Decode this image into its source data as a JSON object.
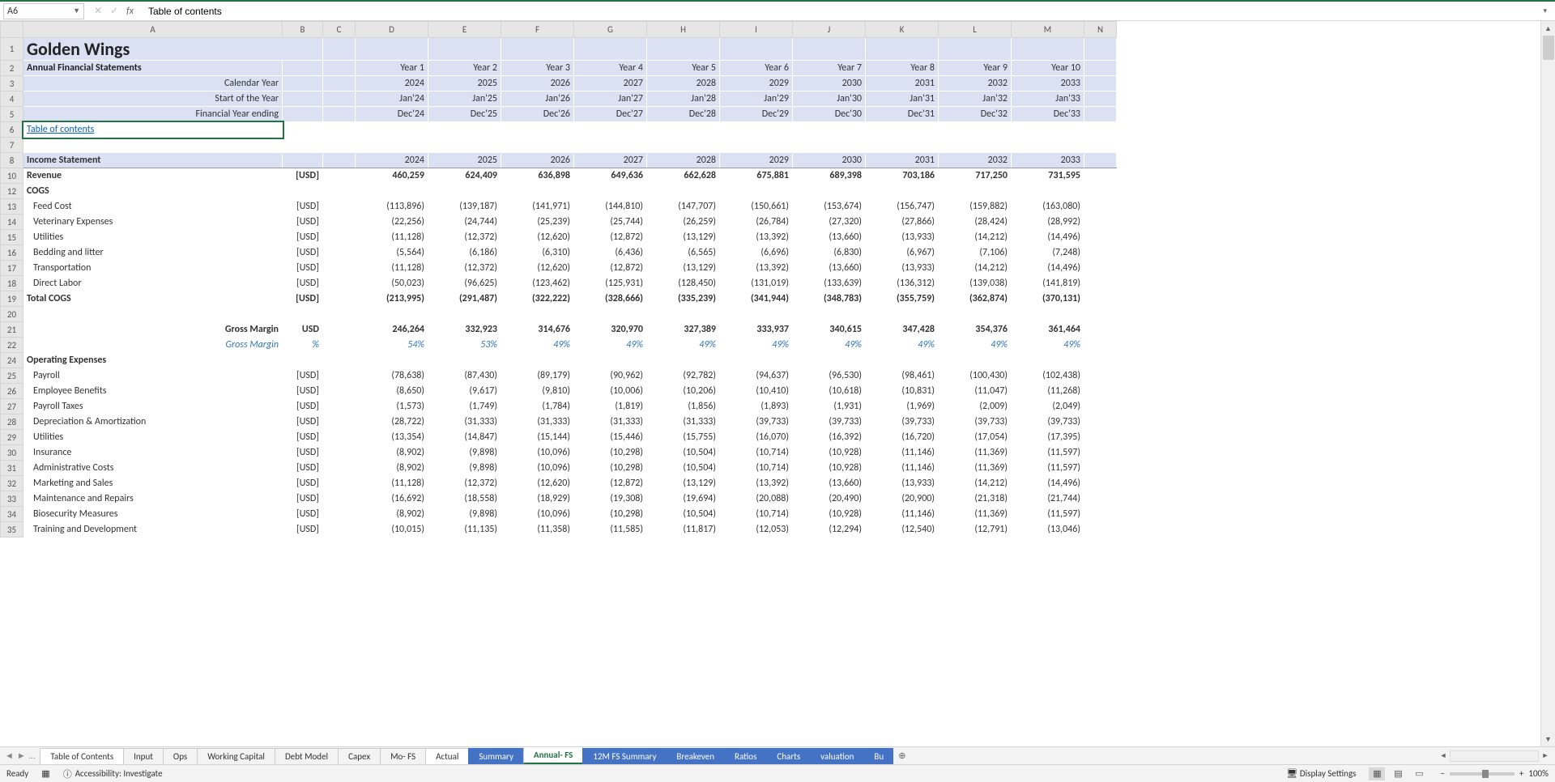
{
  "namebox": "A6",
  "formula": "Table of contents",
  "columns": [
    "",
    "A",
    "B",
    "C",
    "D",
    "E",
    "F",
    "G",
    "H",
    "I",
    "J",
    "K",
    "L",
    "M",
    "N"
  ],
  "header": {
    "title": "Golden Wings",
    "subtitle": "Annual Financial Statements",
    "rows": [
      {
        "label": "",
        "vals": [
          "Year 1",
          "Year 2",
          "Year 3",
          "Year 4",
          "Year 5",
          "Year 6",
          "Year 7",
          "Year 8",
          "Year 9",
          "Year 10"
        ]
      },
      {
        "label": "Calendar Year",
        "vals": [
          "2024",
          "2025",
          "2026",
          "2027",
          "2028",
          "2029",
          "2030",
          "2031",
          "2032",
          "2033"
        ]
      },
      {
        "label": "Start of the Year",
        "vals": [
          "Jan'24",
          "Jan'25",
          "Jan'26",
          "Jan'27",
          "Jan'28",
          "Jan'29",
          "Jan'30",
          "Jan'31",
          "Jan'32",
          "Jan'33"
        ]
      },
      {
        "label": "Financial Year ending",
        "vals": [
          "Dec'24",
          "Dec'25",
          "Dec'26",
          "Dec'27",
          "Dec'28",
          "Dec'29",
          "Dec'30",
          "Dec'31",
          "Dec'32",
          "Dec'33"
        ]
      }
    ]
  },
  "toc": "Table of contents",
  "income_header": {
    "label": "Income Statement",
    "vals": [
      "2024",
      "2025",
      "2026",
      "2027",
      "2028",
      "2029",
      "2030",
      "2031",
      "2032",
      "2033"
    ]
  },
  "revenue": {
    "label": "Revenue",
    "unit": "[USD]",
    "vals": [
      "460,259",
      "624,409",
      "636,898",
      "649,636",
      "662,628",
      "675,881",
      "689,398",
      "703,186",
      "717,250",
      "731,595"
    ]
  },
  "cogs_label": "COGS",
  "cogs": [
    {
      "label": "Feed Cost",
      "unit": "[USD]",
      "vals": [
        "(113,896)",
        "(139,187)",
        "(141,971)",
        "(144,810)",
        "(147,707)",
        "(150,661)",
        "(153,674)",
        "(156,747)",
        "(159,882)",
        "(163,080)"
      ]
    },
    {
      "label": "Veterinary Expenses",
      "unit": "[USD]",
      "vals": [
        "(22,256)",
        "(24,744)",
        "(25,239)",
        "(25,744)",
        "(26,259)",
        "(26,784)",
        "(27,320)",
        "(27,866)",
        "(28,424)",
        "(28,992)"
      ]
    },
    {
      "label": "Utilities",
      "unit": "[USD]",
      "vals": [
        "(11,128)",
        "(12,372)",
        "(12,620)",
        "(12,872)",
        "(13,129)",
        "(13,392)",
        "(13,660)",
        "(13,933)",
        "(14,212)",
        "(14,496)"
      ]
    },
    {
      "label": "Bedding and litter",
      "unit": "[USD]",
      "vals": [
        "(5,564)",
        "(6,186)",
        "(6,310)",
        "(6,436)",
        "(6,565)",
        "(6,696)",
        "(6,830)",
        "(6,967)",
        "(7,106)",
        "(7,248)"
      ]
    },
    {
      "label": "Transportation",
      "unit": "[USD]",
      "vals": [
        "(11,128)",
        "(12,372)",
        "(12,620)",
        "(12,872)",
        "(13,129)",
        "(13,392)",
        "(13,660)",
        "(13,933)",
        "(14,212)",
        "(14,496)"
      ]
    },
    {
      "label": "Direct Labor",
      "unit": "[USD]",
      "vals": [
        "(50,023)",
        "(96,625)",
        "(123,462)",
        "(125,931)",
        "(128,450)",
        "(131,019)",
        "(133,639)",
        "(136,312)",
        "(139,038)",
        "(141,819)"
      ]
    }
  ],
  "total_cogs": {
    "label": "Total COGS",
    "unit": "[USD]",
    "vals": [
      "(213,995)",
      "(291,487)",
      "(322,222)",
      "(328,666)",
      "(335,239)",
      "(341,944)",
      "(348,783)",
      "(355,759)",
      "(362,874)",
      "(370,131)"
    ]
  },
  "gross_margin": {
    "label": "Gross Margin",
    "unit": "USD",
    "vals": [
      "246,264",
      "332,923",
      "314,676",
      "320,970",
      "327,389",
      "333,937",
      "340,615",
      "347,428",
      "354,376",
      "361,464"
    ]
  },
  "gross_margin_pct": {
    "label": "Gross Margin",
    "unit": "%",
    "vals": [
      "54%",
      "53%",
      "49%",
      "49%",
      "49%",
      "49%",
      "49%",
      "49%",
      "49%",
      "49%"
    ]
  },
  "opex_label": "Operating Expenses",
  "opex": [
    {
      "label": "Payroll",
      "unit": "[USD]",
      "vals": [
        "(78,638)",
        "(87,430)",
        "(89,179)",
        "(90,962)",
        "(92,782)",
        "(94,637)",
        "(96,530)",
        "(98,461)",
        "(100,430)",
        "(102,438)"
      ]
    },
    {
      "label": "Employee Benefits",
      "unit": "[USD]",
      "vals": [
        "(8,650)",
        "(9,617)",
        "(9,810)",
        "(10,006)",
        "(10,206)",
        "(10,410)",
        "(10,618)",
        "(10,831)",
        "(11,047)",
        "(11,268)"
      ]
    },
    {
      "label": "Payroll Taxes",
      "unit": "[USD]",
      "vals": [
        "(1,573)",
        "(1,749)",
        "(1,784)",
        "(1,819)",
        "(1,856)",
        "(1,893)",
        "(1,931)",
        "(1,969)",
        "(2,009)",
        "(2,049)"
      ]
    },
    {
      "label": "Depreciation & Amortization",
      "unit": "[USD]",
      "vals": [
        "(28,722)",
        "(31,333)",
        "(31,333)",
        "(31,333)",
        "(31,333)",
        "(39,733)",
        "(39,733)",
        "(39,733)",
        "(39,733)",
        "(39,733)"
      ]
    },
    {
      "label": "Utilities",
      "unit": "[USD]",
      "vals": [
        "(13,354)",
        "(14,847)",
        "(15,144)",
        "(15,446)",
        "(15,755)",
        "(16,070)",
        "(16,392)",
        "(16,720)",
        "(17,054)",
        "(17,395)"
      ]
    },
    {
      "label": "Insurance",
      "unit": "[USD]",
      "vals": [
        "(8,902)",
        "(9,898)",
        "(10,096)",
        "(10,298)",
        "(10,504)",
        "(10,714)",
        "(10,928)",
        "(11,146)",
        "(11,369)",
        "(11,597)"
      ]
    },
    {
      "label": "Administrative Costs",
      "unit": "[USD]",
      "vals": [
        "(8,902)",
        "(9,898)",
        "(10,096)",
        "(10,298)",
        "(10,504)",
        "(10,714)",
        "(10,928)",
        "(11,146)",
        "(11,369)",
        "(11,597)"
      ]
    },
    {
      "label": "Marketing and Sales",
      "unit": "[USD]",
      "vals": [
        "(11,128)",
        "(12,372)",
        "(12,620)",
        "(12,872)",
        "(13,129)",
        "(13,392)",
        "(13,660)",
        "(13,933)",
        "(14,212)",
        "(14,496)"
      ]
    },
    {
      "label": "Maintenance and Repairs",
      "unit": "[USD]",
      "vals": [
        "(16,692)",
        "(18,558)",
        "(18,929)",
        "(19,308)",
        "(19,694)",
        "(20,088)",
        "(20,490)",
        "(20,900)",
        "(21,318)",
        "(21,744)"
      ]
    },
    {
      "label": "Biosecurity Measures",
      "unit": "[USD]",
      "vals": [
        "(8,902)",
        "(9,898)",
        "(10,096)",
        "(10,298)",
        "(10,504)",
        "(10,714)",
        "(10,928)",
        "(11,146)",
        "(11,369)",
        "(11,597)"
      ]
    },
    {
      "label": "Training and Development",
      "unit": "[USD]",
      "vals": [
        "(10,015)",
        "(11,135)",
        "(11,358)",
        "(11,585)",
        "(11,817)",
        "(12,053)",
        "(12,294)",
        "(12,540)",
        "(12,791)",
        "(13,046)"
      ]
    }
  ],
  "tabs": [
    {
      "label": "Table of Contents",
      "cls": "white"
    },
    {
      "label": "Input",
      "cls": ""
    },
    {
      "label": "Ops",
      "cls": ""
    },
    {
      "label": "Working Capital",
      "cls": ""
    },
    {
      "label": "Debt Model",
      "cls": ""
    },
    {
      "label": "Capex",
      "cls": ""
    },
    {
      "label": "Mo- FS",
      "cls": ""
    },
    {
      "label": "Actual",
      "cls": "white"
    },
    {
      "label": "Summary",
      "cls": "blue"
    },
    {
      "label": "Annual- FS",
      "cls": "green"
    },
    {
      "label": "12M FS Summary",
      "cls": "blue"
    },
    {
      "label": "Breakeven",
      "cls": "blue"
    },
    {
      "label": "Ratios",
      "cls": "blue"
    },
    {
      "label": "Charts",
      "cls": "blue"
    },
    {
      "label": "valuation",
      "cls": "blue"
    },
    {
      "label": "Bu",
      "cls": "blue"
    }
  ],
  "status": {
    "ready": "Ready",
    "accessibility": "Accessibility: Investigate",
    "display": "Display Settings",
    "zoom": "100%"
  }
}
